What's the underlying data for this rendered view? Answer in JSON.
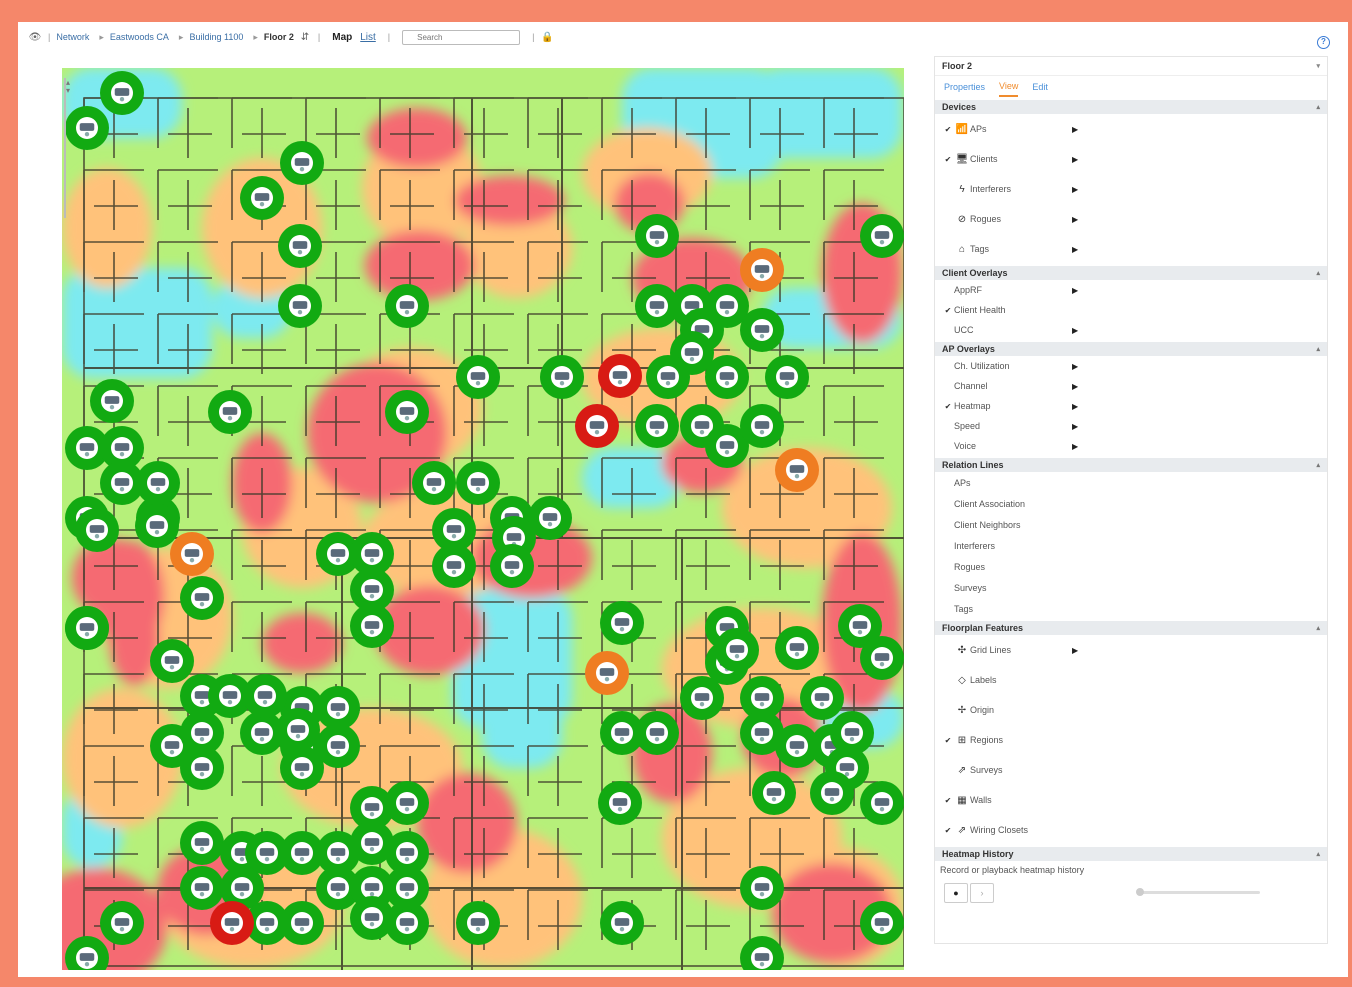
{
  "toolbar": {
    "breadcrumbs": [
      "Network",
      "Eastwoods CA",
      "Building 1100"
    ],
    "current_floor": "Floor 2",
    "view_map": "Map",
    "view_list": "List",
    "search_placeholder": "Search"
  },
  "panel": {
    "floor_title": "Floor 2",
    "tabs": [
      "Properties",
      "View",
      "Edit"
    ],
    "active_tab": "View",
    "sections": {
      "devices": {
        "title": "Devices",
        "items": [
          {
            "label": "APs",
            "checked": true,
            "icon": "ap-icon",
            "arrow": true
          },
          {
            "label": "Clients",
            "checked": true,
            "icon": "monitor-icon",
            "arrow": true
          },
          {
            "label": "Interferers",
            "checked": false,
            "icon": "interferer-icon",
            "arrow": true
          },
          {
            "label": "Rogues",
            "checked": false,
            "icon": "rogue-icon",
            "arrow": true
          },
          {
            "label": "Tags",
            "checked": false,
            "icon": "tag-icon",
            "arrow": true
          }
        ]
      },
      "client_overlays": {
        "title": "Client Overlays",
        "items": [
          {
            "label": "AppRF",
            "checked": false,
            "arrow": true
          },
          {
            "label": "Client Health",
            "checked": true,
            "arrow": false
          },
          {
            "label": "UCC",
            "checked": false,
            "arrow": true
          }
        ]
      },
      "ap_overlays": {
        "title": "AP Overlays",
        "items": [
          {
            "label": "Ch. Utilization",
            "checked": false,
            "arrow": true
          },
          {
            "label": "Channel",
            "checked": false,
            "arrow": true
          },
          {
            "label": "Heatmap",
            "checked": true,
            "arrow": true
          },
          {
            "label": "Speed",
            "checked": false,
            "arrow": true
          },
          {
            "label": "Voice",
            "checked": false,
            "arrow": true
          }
        ]
      },
      "relation_lines": {
        "title": "Relation Lines",
        "items": [
          "APs",
          "Client Association",
          "Client Neighbors",
          "Interferers",
          "Rogues",
          "Surveys",
          "Tags"
        ]
      },
      "floorplan_features": {
        "title": "Floorplan Features",
        "items": [
          {
            "label": "Grid Lines",
            "checked": false,
            "icon": "grid-icon",
            "arrow": true
          },
          {
            "label": "Labels",
            "checked": false,
            "icon": "label-icon",
            "arrow": false
          },
          {
            "label": "Origin",
            "checked": false,
            "icon": "origin-icon",
            "arrow": false
          },
          {
            "label": "Regions",
            "checked": true,
            "icon": "regions-icon",
            "arrow": false
          },
          {
            "label": "Surveys",
            "checked": false,
            "icon": "survey-icon",
            "arrow": false
          },
          {
            "label": "Walls",
            "checked": true,
            "icon": "walls-icon",
            "arrow": false
          },
          {
            "label": "Wiring Closets",
            "checked": true,
            "icon": "wiring-icon",
            "arrow": false
          }
        ]
      },
      "heatmap_history": {
        "title": "Heatmap History",
        "description": "Record or playback heatmap history"
      }
    }
  },
  "colors": {
    "heat_green": "#b6f07a",
    "heat_orange": "#ffc27a",
    "heat_red": "#f56a72",
    "heat_cyan": "#7deaf0",
    "ap_green": "#12aa12",
    "ap_orange": "#ef7d22",
    "ap_red": "#d81b14",
    "accent": "#f08c2e",
    "link": "#3a6ea5"
  }
}
